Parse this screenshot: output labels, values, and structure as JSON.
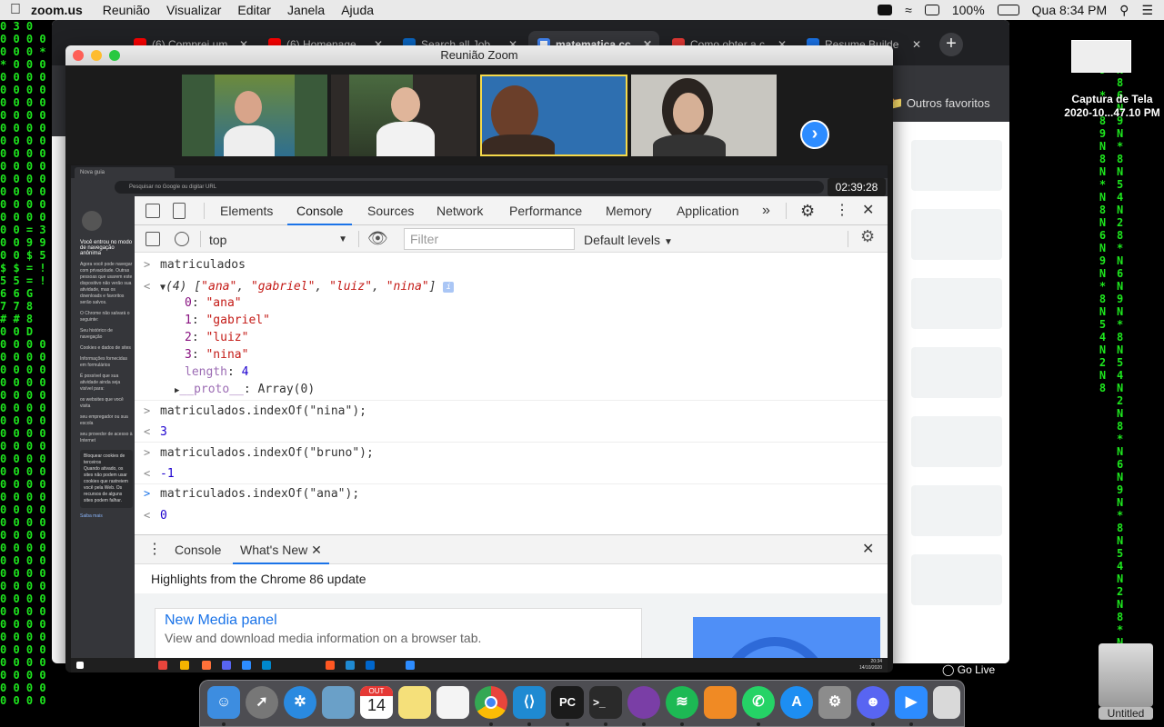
{
  "menubar": {
    "app_name": "zoom.us",
    "items": [
      "Reunião",
      "Visualizar",
      "Editar",
      "Janela",
      "Ajuda"
    ],
    "battery": "100%",
    "clock": "Qua 8:34 PM"
  },
  "chrome_back": {
    "tabs": [
      {
        "label": "(6) Comprei um",
        "icon": "youtube-icon",
        "color": "#ff0000"
      },
      {
        "label": "(6) Homenage",
        "icon": "youtube-icon",
        "color": "#ff0000"
      },
      {
        "label": "Search all Job",
        "icon": "linkedin-icon",
        "color": "#0a66c2"
      },
      {
        "label": "matematica cc",
        "icon": "google-icon",
        "color": "#4285f4"
      },
      {
        "label": "Como obter a c",
        "icon": "qa-icon",
        "color": "#e53935"
      },
      {
        "label": "Resume Builde",
        "icon": "document-icon",
        "color": "#1a73e8"
      }
    ],
    "favorites_label": "Outros favoritos"
  },
  "zoom": {
    "title": "Reunião Zoom",
    "participants": [
      {
        "name": "participant-1",
        "bg": "#3a5a3a"
      },
      {
        "name": "participant-2",
        "bg": "#4a4440"
      },
      {
        "name": "participant-3",
        "bg": "#2e6fb0"
      },
      {
        "name": "participant-4",
        "bg": "#c8c6c0"
      }
    ],
    "timer": "02:39:28"
  },
  "shared_browser": {
    "tab_label": "Nova guia",
    "url_placeholder": "Pesquisar no Google ou digitar URL",
    "incognito": {
      "title": "Você entrou no modo de navegação anônima",
      "p1": "Agora você pode navegar com privacidade. Outras pessoas que usarem este dispositivo não verão sua atividade, mas os downloads e favoritos serão salvos.",
      "p2": "O Chrome não salvará o seguinte:",
      "list1": [
        "Seu histórico de navegação",
        "Cookies e dados de sites",
        "Informações fornecidas em formulários"
      ],
      "p3": "É possível que sua atividade ainda seja visível para:",
      "list2": [
        "os websites que você visita",
        "seu empregador ou sua escola",
        "seu provedor de acesso à Internet"
      ],
      "box_title": "Bloquear cookies de terceiros",
      "box_text": "Quando ativado, os sites não podem usar cookies que rastreiem você pela Web. Os recursos de alguns sites podem falhar.",
      "learn_more": "Saiba mais"
    },
    "taskbar_time": "20:34",
    "taskbar_date": "14/10/2020"
  },
  "devtools": {
    "tabs": [
      "Elements",
      "Console",
      "Sources",
      "Network",
      "Performance",
      "Memory",
      "Application"
    ],
    "active_tab": "Console",
    "more_tabs": "»",
    "context": "top",
    "filter_placeholder": "Filter",
    "levels": "Default levels",
    "console": {
      "input1": "matriculados",
      "array_count": "(4)",
      "array_items": [
        "\"ana\"",
        "\"gabriel\"",
        "\"luiz\"",
        "\"nina\""
      ],
      "expanded": [
        {
          "idx": "0",
          "val": "\"ana\""
        },
        {
          "idx": "1",
          "val": "\"gabriel\""
        },
        {
          "idx": "2",
          "val": "\"luiz\""
        },
        {
          "idx": "3",
          "val": "\"nina\""
        }
      ],
      "length_key": "length",
      "length_val": "4",
      "proto_key": "__proto__",
      "proto_val": "Array(0)",
      "commands": [
        {
          "input": "matriculados.indexOf(\"nina\");",
          "output": "3"
        },
        {
          "input": "matriculados.indexOf(\"bruno\");",
          "output": "-1"
        },
        {
          "input": "matriculados.indexOf(\"ana\");",
          "output": "0"
        }
      ]
    },
    "drawer": {
      "tabs": [
        "Console",
        "What's New"
      ],
      "active_tab": "What's New",
      "highlights": "Highlights from the Chrome 86 update",
      "card_title": "New Media panel",
      "card_subtitle": "View and download media information on a browser tab."
    }
  },
  "desktop": {
    "screenshot_label": "Captura de Tela 2020-10...47.10 PM",
    "go_live": "Go Live",
    "disk_label": "Untitled"
  },
  "dock": {
    "calendar_month": "OUT",
    "calendar_day": "14",
    "apps": [
      {
        "name": "finder-icon",
        "color": "#3d8de0"
      },
      {
        "name": "launchpad-icon",
        "color": "#777"
      },
      {
        "name": "safari-icon",
        "color": "#2a8ae0"
      },
      {
        "name": "preview-icon",
        "color": "#6aa0c8"
      },
      {
        "name": "calendar-icon",
        "color": "#ffffff"
      },
      {
        "name": "notes-icon",
        "color": "#f5e07a"
      },
      {
        "name": "reminders-icon",
        "color": "#f4f4f4"
      },
      {
        "name": "chrome-icon",
        "color": "#e8453c"
      },
      {
        "name": "vscode-icon",
        "color": "#1f8ad2"
      },
      {
        "name": "pycharm-icon",
        "color": "#1b1b1b"
      },
      {
        "name": "terminal-icon",
        "color": "#2a2a2a"
      },
      {
        "name": "github-desktop-icon",
        "color": "#7a3ea6"
      },
      {
        "name": "spotify-icon",
        "color": "#1db954"
      },
      {
        "name": "fl-studio-icon",
        "color": "#f08a24"
      },
      {
        "name": "whatsapp-icon",
        "color": "#25d366"
      },
      {
        "name": "app-store-icon",
        "color": "#1d8ef2"
      },
      {
        "name": "system-preferences-icon",
        "color": "#8c8c8c"
      },
      {
        "name": "discord-icon",
        "color": "#5865f2"
      },
      {
        "name": "zoom-icon",
        "color": "#2d8cff"
      },
      {
        "name": "trash-icon",
        "color": "#d9d9d9"
      }
    ]
  }
}
